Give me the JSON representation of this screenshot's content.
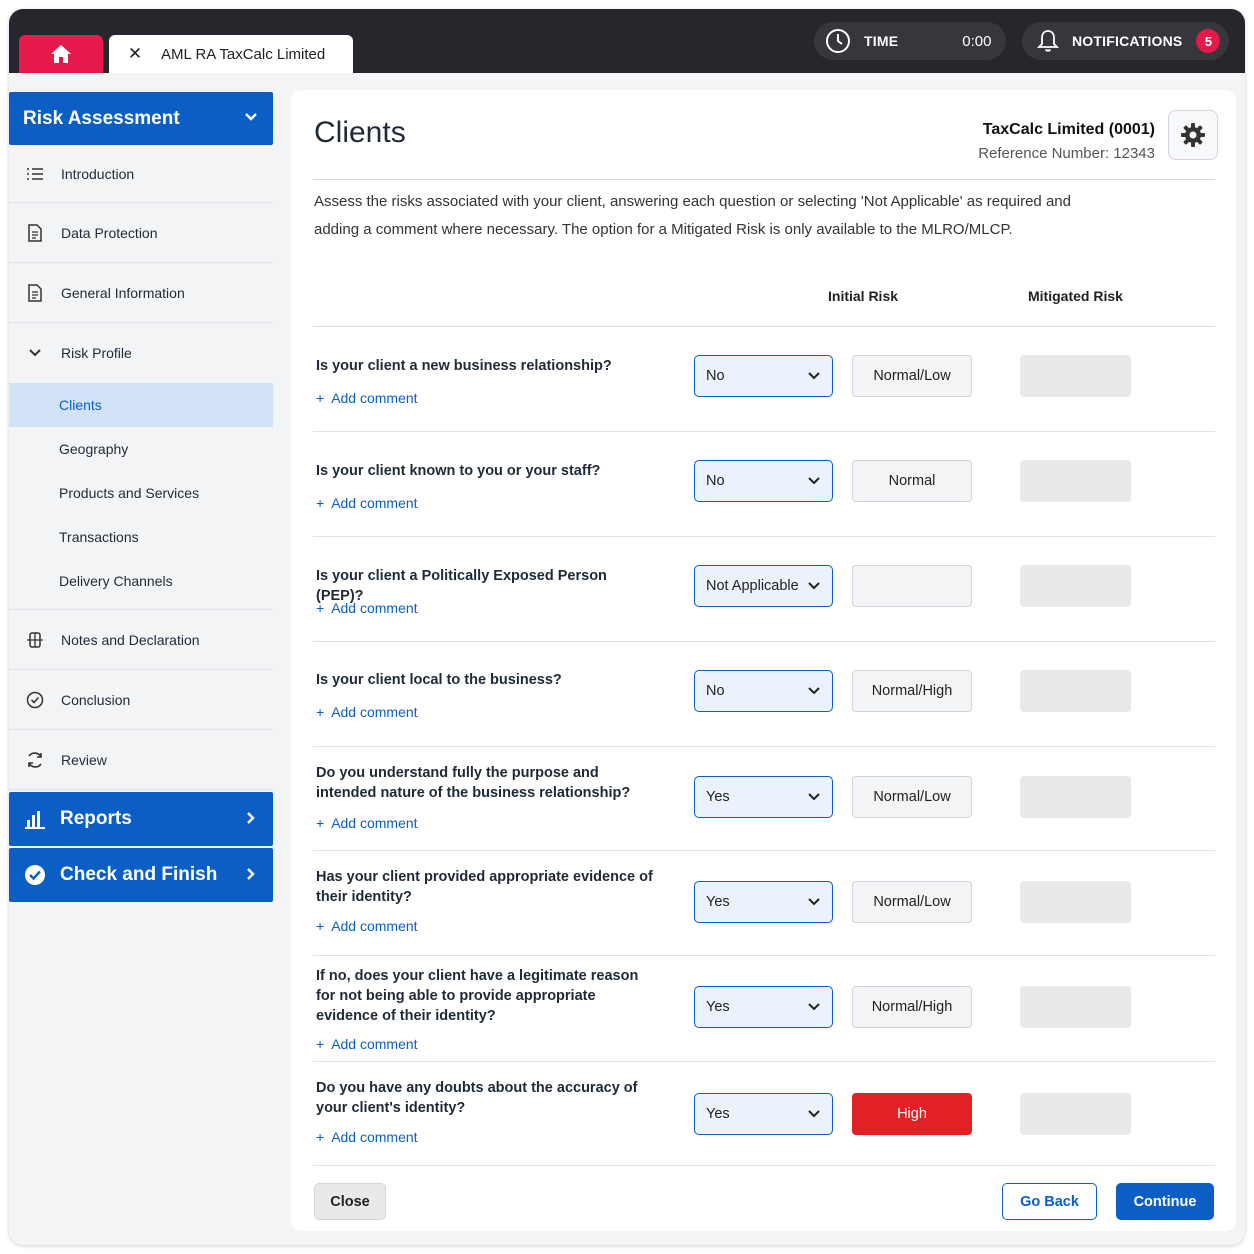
{
  "topbar": {
    "tab_title": "AML RA TaxCalc Limited",
    "time_label": "TIME",
    "time_value": "0:00",
    "notifications_label": "NOTIFICATIONS",
    "notifications_count": "5",
    "accent_color": "#e6194b"
  },
  "sidebar": {
    "section_title": "Risk Assessment",
    "items": [
      {
        "label": "Introduction",
        "icon": "list-icon"
      },
      {
        "label": "Data Protection",
        "icon": "document-icon"
      },
      {
        "label": "General Information",
        "icon": "document-icon"
      },
      {
        "label": "Risk Profile",
        "icon": "chevron-down-icon"
      }
    ],
    "risk_profile_subitems": [
      "Clients",
      "Geography",
      "Products and Services",
      "Transactions",
      "Delivery Channels"
    ],
    "active_subitem": "Clients",
    "items_after": [
      {
        "label": "Notes and Declaration",
        "icon": "globe-icon"
      },
      {
        "label": "Conclusion",
        "icon": "check-circle-icon"
      },
      {
        "label": "Review",
        "icon": "refresh-icon"
      }
    ],
    "reports_label": "Reports",
    "check_finish_label": "Check and Finish",
    "primary_color": "#0b5ec4"
  },
  "main": {
    "title": "Clients",
    "company_name": "TaxCalc Limited (0001)",
    "reference": "Reference Number: 12343",
    "intro": "Assess the risks associated with your client, answering each question or selecting 'Not Applicable' as required and adding a comment where necessary.   The option for a Mitigated Risk is only available to the MLRO/MLCP.",
    "col_initial": "Initial Risk",
    "col_mitigated": "Mitigated Risk",
    "add_comment": "Add comment",
    "questions": [
      {
        "text": "Is your client a new business relationship?",
        "answer": "No",
        "risk": "Normal/Low"
      },
      {
        "text": "Is your client known to you or your staff?",
        "answer": "No",
        "risk": "Normal"
      },
      {
        "text": "Is your client a Politically Exposed Person (PEP)?",
        "answer": "Not Applicable",
        "risk": ""
      },
      {
        "text": "Is your client local to the business?",
        "answer": "No",
        "risk": "Normal/High"
      },
      {
        "text": "Do you understand fully the purpose and intended nature of the business relationship?",
        "answer": "Yes",
        "risk": "Normal/Low"
      },
      {
        "text": "Has your client provided appropriate evidence of their identity?",
        "answer": "Yes",
        "risk": "Normal/Low"
      },
      {
        "text": "If no, does your client have a legitimate reason for not being able to provide appropriate evidence of their identity?",
        "answer": "Yes",
        "risk": "Normal/High"
      },
      {
        "text": "Do you have any doubts about the accuracy of your client's identity?",
        "answer": "Yes",
        "risk": "High"
      }
    ],
    "high_risk_color": "#e32125",
    "close_label": "Close",
    "go_back_label": "Go Back",
    "continue_label": "Continue"
  }
}
